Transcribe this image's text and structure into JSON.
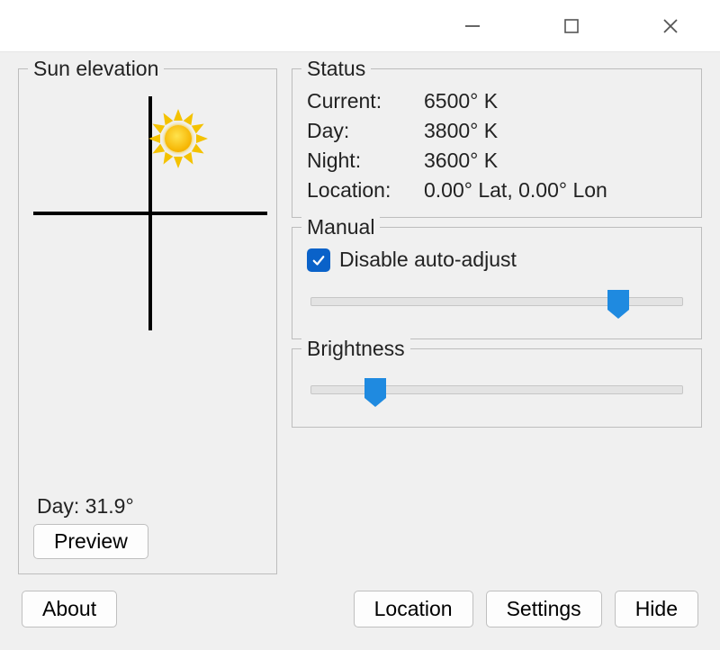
{
  "sun_elevation": {
    "legend": "Sun elevation",
    "day_label": "Day: 31.9°",
    "preview_label": "Preview"
  },
  "status": {
    "legend": "Status",
    "current_k": "Current:",
    "current_v": "6500° K",
    "day_k": "Day:",
    "day_v": "3800° K",
    "night_k": "Night:",
    "night_v": "3600° K",
    "location_k": "Location:",
    "location_v": "0.00° Lat, 0.00° Lon"
  },
  "manual": {
    "legend": "Manual",
    "checkbox_label": "Disable auto-adjust",
    "checked": true,
    "slider_percent": 82
  },
  "brightness": {
    "legend": "Brightness",
    "slider_percent": 18
  },
  "buttons": {
    "about": "About",
    "location": "Location",
    "settings": "Settings",
    "hide": "Hide"
  }
}
